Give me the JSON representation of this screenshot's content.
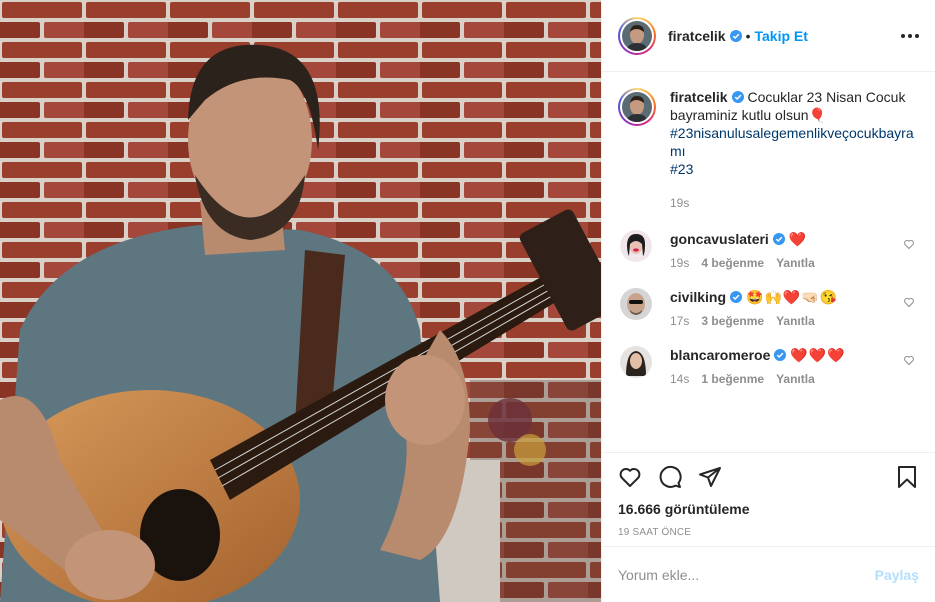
{
  "post": {
    "author": {
      "username": "firatcelik",
      "verified": true,
      "follow_label": "Takip Et",
      "separator": "•"
    },
    "caption": {
      "username": "firatcelik",
      "text": "Cocuklar 23 Nisan Cocuk bayraminiz kutlu olsun🎈",
      "hashtags": [
        "#23nisanulusalegemenlikveçocukbayramı",
        "#23"
      ],
      "time": "19s"
    },
    "comments": [
      {
        "username": "goncavuslateri",
        "verified": true,
        "text": "❤️",
        "time": "19s",
        "likes": "4 beğenme",
        "reply": "Yanıtla"
      },
      {
        "username": "civilking",
        "verified": true,
        "text": "🤩🙌❤️🤜🏻😘",
        "time": "17s",
        "likes": "3 beğenme",
        "reply": "Yanıtla"
      },
      {
        "username": "blancaromeroe",
        "verified": true,
        "text": "❤️❤️❤️",
        "time": "14s",
        "likes": "1 beğenme",
        "reply": "Yanıtla"
      }
    ],
    "views": "16.666 görüntüleme",
    "timestamp": "19 SAAT ÖNCE",
    "add_comment": {
      "placeholder": "Yorum ekle...",
      "share_label": "Paylaş"
    }
  },
  "colors": {
    "accent": "#0095f6",
    "hashtag": "#00376b",
    "muted": "#8e8e8e",
    "share_disabled": "#b2dffc",
    "brick": "#8b3a2b"
  },
  "icons": [
    "heart-icon",
    "comment-icon",
    "share-icon",
    "bookmark-icon",
    "more-icon",
    "verified-icon"
  ]
}
